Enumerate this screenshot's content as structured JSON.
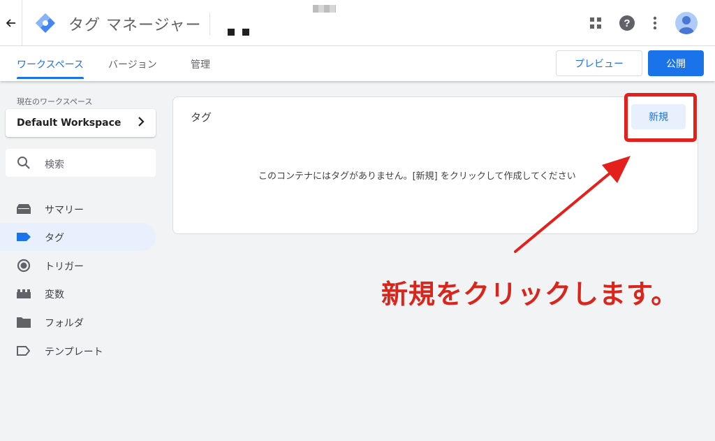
{
  "header": {
    "app_title": "タグ マネージャー",
    "back_icon": "arrow-left-icon",
    "help_glyph": "?"
  },
  "tabs": [
    {
      "label": "ワークスペース",
      "active": true
    },
    {
      "label": "バージョン",
      "active": false
    },
    {
      "label": "管理",
      "active": false
    }
  ],
  "actions": {
    "preview_label": "プレビュー",
    "publish_label": "公開"
  },
  "sidebar": {
    "workspace_caption": "現在のワークスペース",
    "workspace_name": "Default Workspace",
    "search_placeholder": "検索",
    "items": [
      {
        "label": "サマリー",
        "icon": "summary-icon",
        "active": false
      },
      {
        "label": "タグ",
        "icon": "tag-icon",
        "active": true
      },
      {
        "label": "トリガー",
        "icon": "trigger-icon",
        "active": false
      },
      {
        "label": "変数",
        "icon": "variable-icon",
        "active": false
      },
      {
        "label": "フォルダ",
        "icon": "folder-icon",
        "active": false
      },
      {
        "label": "テンプレート",
        "icon": "template-icon",
        "active": false
      }
    ]
  },
  "main": {
    "card_title": "タグ",
    "new_button": "新規",
    "empty_message": "このコンテナにはタグがありません。[新規] をクリックして作成してください"
  },
  "annotation": {
    "text": "新規をクリックします。",
    "color": "#e3201b"
  },
  "colors": {
    "accent": "#1a73e8",
    "active_bg": "#e8f0fe"
  }
}
